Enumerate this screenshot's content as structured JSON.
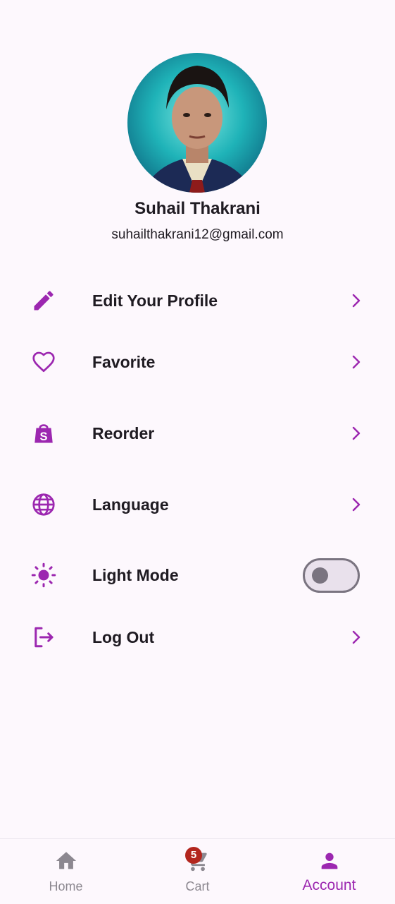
{
  "profile": {
    "name": "Suhail Thakrani",
    "email": "suhailthakrani12@gmail.com"
  },
  "menu": [
    {
      "label": "Edit Your Profile",
      "icon": "edit-pencil-icon"
    },
    {
      "label": "Favorite",
      "icon": "heart-icon"
    },
    {
      "label": "Reorder",
      "icon": "shopping-bag-icon"
    },
    {
      "label": "Language",
      "icon": "globe-icon"
    },
    {
      "label": "Light Mode",
      "icon": "sun-icon",
      "toggle": false
    },
    {
      "label": "Log Out",
      "icon": "logout-icon"
    }
  ],
  "bottom_nav": {
    "items": [
      {
        "label": "Home",
        "icon": "home-icon",
        "active": false
      },
      {
        "label": "Cart",
        "icon": "cart-icon",
        "active": false,
        "badge": "5"
      },
      {
        "label": "Account",
        "icon": "person-icon",
        "active": true
      }
    ]
  },
  "colors": {
    "accent": "#9c27b0",
    "background": "#fdf8fd",
    "badge": "#b3261e",
    "inactive": "#8c8890"
  }
}
